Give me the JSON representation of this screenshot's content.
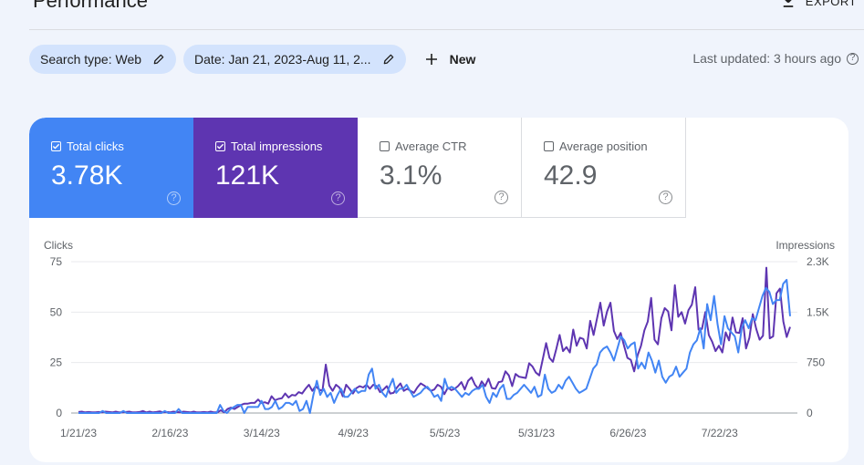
{
  "header": {
    "title": "Performance",
    "export_label": "EXPORT"
  },
  "filters": {
    "search_type": "Search type: Web",
    "date": "Date: Jan 21, 2023-Aug 11, 2...",
    "new_label": "New"
  },
  "status": {
    "last_updated": "Last updated: 3 hours ago"
  },
  "metrics": [
    {
      "label": "Total clicks",
      "value": "3.78K",
      "checked": true,
      "color": "#4285f4"
    },
    {
      "label": "Total impressions",
      "value": "121K",
      "checked": true,
      "color": "#5e35b1"
    },
    {
      "label": "Average CTR",
      "value": "3.1%",
      "checked": false
    },
    {
      "label": "Average position",
      "value": "42.9",
      "checked": false
    }
  ],
  "chart_data": {
    "type": "line",
    "left_axis": {
      "label": "Clicks",
      "ticks": [
        "0",
        "25",
        "50",
        "75"
      ],
      "range": [
        0,
        75
      ]
    },
    "right_axis": {
      "label": "Impressions",
      "ticks": [
        "0",
        "750",
        "1.5K",
        "2.3K"
      ],
      "range": [
        0,
        2250
      ]
    },
    "x_ticks": [
      "1/21/23",
      "2/16/23",
      "3/14/23",
      "4/9/23",
      "5/5/23",
      "5/31/23",
      "6/26/23",
      "7/22/23"
    ],
    "x_range_days": [
      0,
      202
    ],
    "grid": true,
    "series": [
      {
        "name": "Clicks",
        "axis": "left",
        "color": "#4285f4",
        "values": [
          0,
          0,
          0,
          0,
          0,
          0,
          0,
          1,
          0,
          0,
          0,
          0,
          0,
          1,
          0,
          0,
          0,
          0,
          0,
          0,
          0,
          0,
          0,
          0,
          0,
          1,
          0,
          0,
          0,
          2,
          0,
          0,
          0,
          0,
          0,
          0,
          0,
          0,
          0,
          0,
          0,
          4,
          1,
          0,
          2,
          3,
          4,
          4,
          0,
          3,
          3,
          3,
          3,
          6,
          2,
          2,
          3,
          6,
          2,
          3,
          5,
          5,
          4,
          6,
          1,
          2,
          6,
          0,
          9,
          16,
          9,
          12,
          8,
          10,
          5,
          9,
          12,
          8,
          8,
          10,
          12,
          10,
          11,
          11,
          19,
          22,
          12,
          14,
          10,
          8,
          13,
          17,
          10,
          12,
          12,
          14,
          11,
          8,
          9,
          10,
          12,
          13,
          11,
          8,
          9,
          6,
          17,
          12,
          13,
          12,
          10,
          8,
          10,
          9,
          11,
          12,
          12,
          14,
          8,
          5,
          10,
          8,
          12,
          14,
          7,
          7,
          9,
          10,
          12,
          14,
          12,
          10,
          13,
          8,
          9,
          19,
          12,
          10,
          11,
          14,
          12,
          16,
          18,
          15,
          12,
          10,
          11,
          12,
          17,
          22,
          24,
          30,
          32,
          33,
          30,
          26,
          32,
          38,
          36,
          32,
          34,
          35,
          22,
          25,
          22,
          30,
          26,
          20,
          26,
          18,
          15,
          18,
          19,
          23,
          18,
          20,
          22,
          30,
          34,
          36,
          42,
          32,
          54,
          46,
          58,
          44,
          34,
          48,
          42,
          40,
          38,
          30,
          42,
          46,
          42,
          47,
          46,
          52,
          58,
          62,
          60,
          54,
          56,
          56,
          64,
          66,
          48
        ]
      },
      {
        "name": "Impressions",
        "axis": "right",
        "color": "#5e35b1",
        "values": [
          15,
          20,
          10,
          15,
          10,
          10,
          15,
          10,
          20,
          15,
          10,
          20,
          10,
          10,
          15,
          20,
          10,
          10,
          15,
          30,
          10,
          20,
          10,
          15,
          25,
          10,
          15,
          10,
          20,
          15,
          10,
          20,
          15,
          10,
          20,
          10,
          10,
          15,
          10,
          20,
          10,
          10,
          40,
          10,
          60,
          80,
          60,
          90,
          120,
          140,
          140,
          150,
          150,
          200,
          150,
          160,
          140,
          250,
          190,
          210,
          220,
          290,
          230,
          270,
          260,
          310,
          290,
          360,
          420,
          330,
          400,
          350,
          330,
          720,
          410,
          330,
          420,
          380,
          250,
          420,
          360,
          290,
          370,
          400,
          380,
          420,
          360,
          420,
          400,
          310,
          350,
          400,
          290,
          300,
          380,
          440,
          330,
          360,
          330,
          300,
          380,
          440,
          410,
          370,
          330,
          350,
          420,
          390,
          280,
          380,
          340,
          360,
          400,
          460,
          350,
          480,
          530,
          420,
          360,
          470,
          400,
          510,
          370,
          360,
          460,
          470,
          620,
          560,
          400,
          580,
          540,
          530,
          520,
          740,
          690,
          600,
          560,
          800,
          1040,
          820,
          760,
          950,
          1160,
          920,
          980,
          900,
          1240,
          1000,
          1120,
          1100,
          960,
          1370,
          1160,
          1400,
          1640,
          1300,
          1510,
          1640,
          1220,
          1100,
          1190,
          1000,
          820,
          790,
          620,
          860,
          1000,
          1230,
          1360,
          1710,
          1090,
          1020,
          1410,
          1560,
          1510,
          1230,
          1900,
          1430,
          1500,
          1330,
          1530,
          1610,
          1870,
          1240,
          1250,
          1500,
          1160,
          1060,
          920,
          1000,
          900,
          1200,
          1080,
          1420,
          1200,
          1190,
          1410,
          960,
          1120,
          1470,
          1250,
          1090,
          1150,
          2160,
          1110,
          1140,
          1780,
          1850,
          1360,
          1130,
          1280
        ]
      }
    ]
  }
}
